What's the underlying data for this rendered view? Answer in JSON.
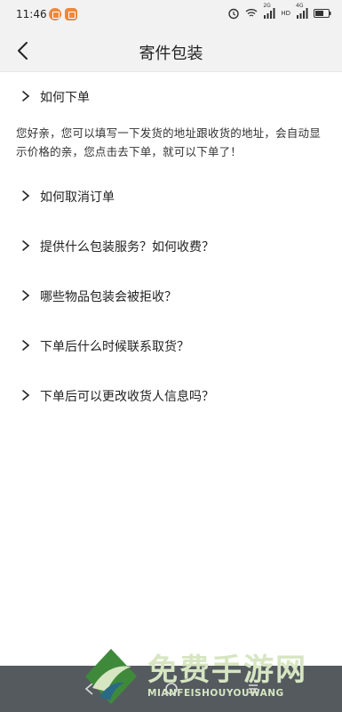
{
  "status_bar": {
    "time": "11:46",
    "net_2g": "2G",
    "net_4g": "4G",
    "hd": "HD"
  },
  "header": {
    "title": "寄件包装",
    "back_icon": "chevron-left-icon"
  },
  "faq": [
    {
      "question": "如何下单",
      "answer": "您好亲，您可以填写一下发货的地址跟收货的地址，会自动显示价格的亲，您点击去下单，就可以下单了！"
    },
    {
      "question": "如何取消订单"
    },
    {
      "question": "提供什么包装服务？如何收费？"
    },
    {
      "question": "哪些物品包装会被拒收？"
    },
    {
      "question": "下单后什么时候联系取货？"
    },
    {
      "question": "下单后可以更改收货人信息吗？"
    }
  ],
  "watermark": {
    "text": "免费手游网",
    "sub": "MIANFEISHOUYOUWANG"
  },
  "colors": {
    "accent_notif": "#f0873a",
    "nav_bg": "#f2f2f2",
    "sys_nav_bg": "#555a5f"
  }
}
